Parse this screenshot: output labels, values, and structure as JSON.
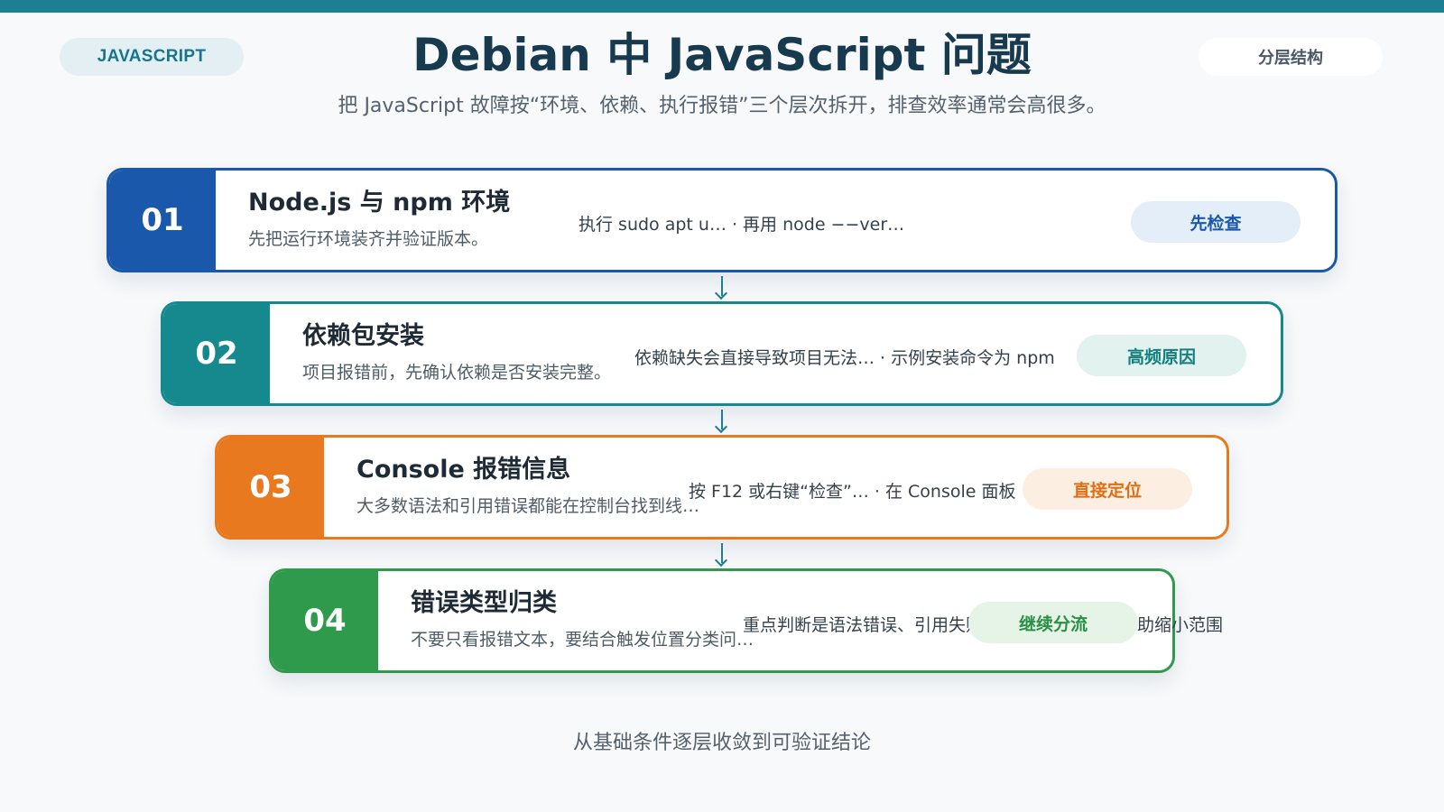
{
  "header": {
    "tag_left": "JAVASCRIPT",
    "title": "Debian 中 JavaScript 问题",
    "subtitle": "把 JavaScript 故障按“环境、依赖、执行报错”三个层次拆开，排查效率通常会高很多。",
    "tag_right": "分层结构"
  },
  "steps": [
    {
      "number": "01",
      "title": "Node.js 与 npm 环境",
      "subtitle": "先把运行环境装齐并验证版本。",
      "detail": "执行 sudo apt u… · 再用 node −−ver…",
      "badge": "先检查",
      "color": "#1958ab",
      "badge_bg": "#e4eef9",
      "badge_fg": "#1958ab"
    },
    {
      "number": "02",
      "title": "依赖包安装",
      "subtitle": "项目报错前，先确认依赖是否安装完整。",
      "detail": "依赖缺失会直接导致项目无法… · 示例安装命令为 npm",
      "badge": "高频原因",
      "color": "#16898e",
      "badge_bg": "#e2f2ef",
      "badge_fg": "#13807f"
    },
    {
      "number": "03",
      "title": "Console 报错信息",
      "subtitle": "大多数语法和引用错误都能在控制台找到线…",
      "detail": "按 F12 或右键“检查”… · 在 Console 面板",
      "badge": "直接定位",
      "color": "#e8791f",
      "badge_bg": "#fdeee2",
      "badge_fg": "#de6f14"
    },
    {
      "number": "04",
      "title": "错误类型归类",
      "subtitle": "不要只看报错文本，要结合触发位置分类问…",
      "detail": "重点判断是语法错误、引用失败还是类型错误，可帮助缩小范围",
      "badge": "继续分流",
      "color": "#2f9a4c",
      "badge_bg": "#e6f4e8",
      "badge_fg": "#2c8f46"
    }
  ],
  "footer": "从基础条件逐层收敛到可验证结论"
}
